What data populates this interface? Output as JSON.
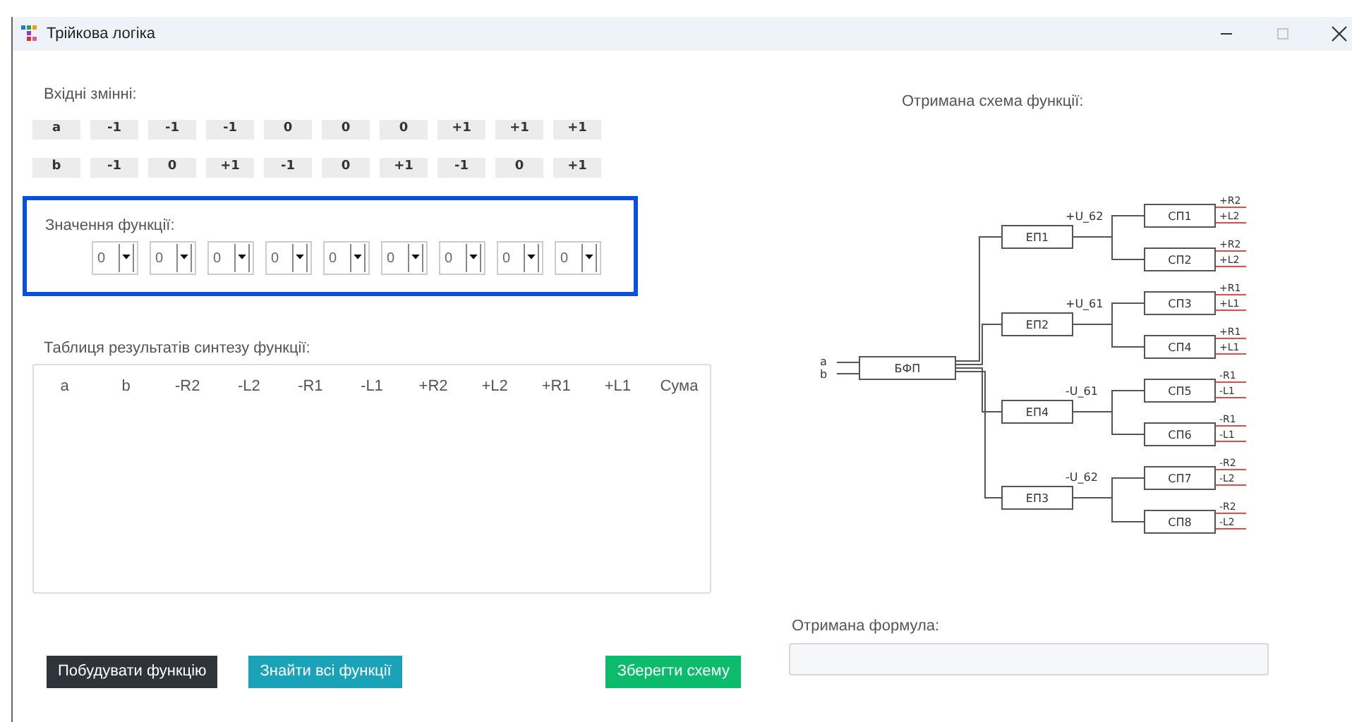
{
  "window": {
    "title": "Трійкова логіка",
    "controls": [
      {
        "kind": "minimize",
        "disabled": false
      },
      {
        "kind": "maximize",
        "disabled": true
      },
      {
        "kind": "close",
        "disabled": false
      }
    ]
  },
  "inputs": {
    "label": "Вхідні змінні:",
    "rows": [
      {
        "name": "a",
        "values": [
          "-1",
          "-1",
          "-1",
          "0",
          "0",
          "0",
          "+1",
          "+1",
          "+1"
        ]
      },
      {
        "name": "b",
        "values": [
          "-1",
          "0",
          "+1",
          "-1",
          "0",
          "+1",
          "-1",
          "0",
          "+1"
        ]
      }
    ]
  },
  "function_values": {
    "label": "Значення функції:",
    "values": [
      "0",
      "0",
      "0",
      "0",
      "0",
      "0",
      "0",
      "0",
      "0"
    ]
  },
  "synthesis_table": {
    "title": "Таблиця результатів синтезу функції:",
    "columns": [
      "a",
      "b",
      "-R2",
      "-L2",
      "-R1",
      "-L1",
      "+R2",
      "+L2",
      "+R1",
      "+L1",
      "Сума"
    ]
  },
  "buttons": [
    {
      "label": "Побудувати функцію",
      "kind": "dark"
    },
    {
      "label": "Знайти всі функції",
      "kind": "info"
    },
    {
      "label": "Зберегти схему",
      "kind": "success"
    }
  ],
  "scheme": {
    "title": "Отримана схема функції:",
    "inputs": [
      "a",
      "b"
    ],
    "main_block": "БФП",
    "branches": [
      {
        "block": "ЕП1",
        "signal": "+U_62",
        "outputs": [
          {
            "block": "СП1",
            "labels": [
              "+R2",
              "+L2"
            ]
          },
          {
            "block": "СП2",
            "labels": [
              "+R2",
              "+L2"
            ]
          }
        ]
      },
      {
        "block": "ЕП2",
        "signal": "+U_61",
        "outputs": [
          {
            "block": "СП3",
            "labels": [
              "+R1",
              "+L1"
            ]
          },
          {
            "block": "СП4",
            "labels": [
              "+R1",
              "+L1"
            ]
          }
        ]
      },
      {
        "block": "ЕП4",
        "signal": "-U_61",
        "outputs": [
          {
            "block": "СП5",
            "labels": [
              "-R1",
              "-L1"
            ]
          },
          {
            "block": "СП6",
            "labels": [
              "-R1",
              "-L1"
            ]
          }
        ]
      },
      {
        "block": "ЕП3",
        "signal": "-U_62",
        "outputs": [
          {
            "block": "СП7",
            "labels": [
              "-R2",
              "-L2"
            ]
          },
          {
            "block": "СП8",
            "labels": [
              "-R2",
              "-L2"
            ]
          }
        ]
      }
    ]
  },
  "formula": {
    "label": "Отримана формула:"
  }
}
